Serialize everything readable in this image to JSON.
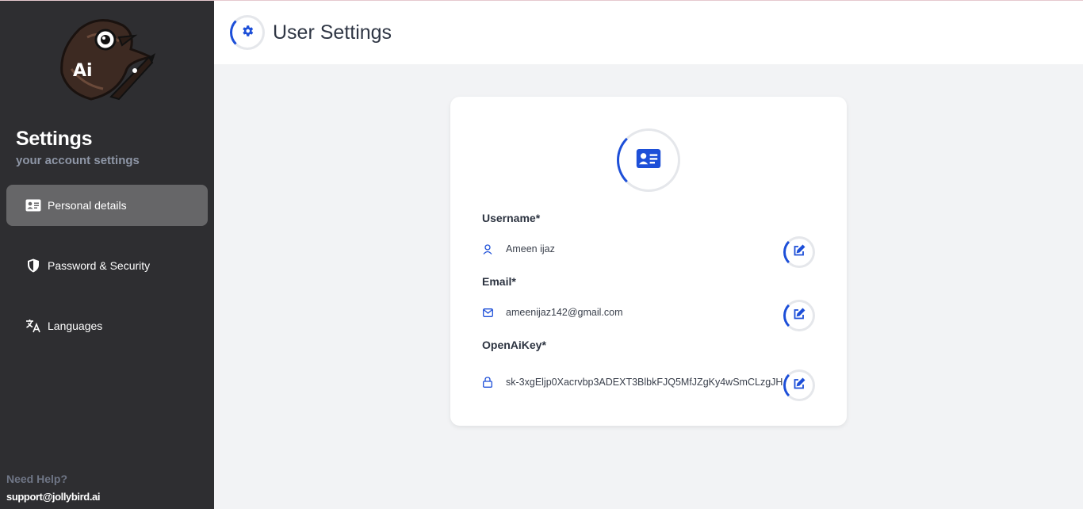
{
  "sidebar": {
    "logo_text": "Ai",
    "title": "Settings",
    "subtitle": "your account settings",
    "items": [
      {
        "label": "Personal details",
        "icon": "id-card-icon",
        "active": true
      },
      {
        "label": "Password & Security",
        "icon": "shield-icon",
        "active": false
      },
      {
        "label": "Languages",
        "icon": "translate-icon",
        "active": false
      }
    ],
    "help_label": "Need Help?",
    "support_email": "support@jollybird.ai"
  },
  "header": {
    "title": "User Settings",
    "icon": "gear-icon"
  },
  "card": {
    "icon": "id-card-icon",
    "fields": [
      {
        "label": "Username*",
        "value": "Ameen ijaz",
        "icon": "user-icon"
      },
      {
        "label": "Email*",
        "value": "ameenijaz142@gmail.com",
        "icon": "mail-icon"
      },
      {
        "label": "OpenAiKey*",
        "value": "sk-3xgEljp0Xacrvbp3ADEXT3BlbkFJQ5MfJZgKy4wSmCLzgJH",
        "icon": "lock-icon"
      }
    ]
  },
  "colors": {
    "accent": "#1d4fd8",
    "sidebar_bg": "#2e2e31",
    "active_item_bg": "#666668",
    "page_bg": "#f2f3f5"
  }
}
